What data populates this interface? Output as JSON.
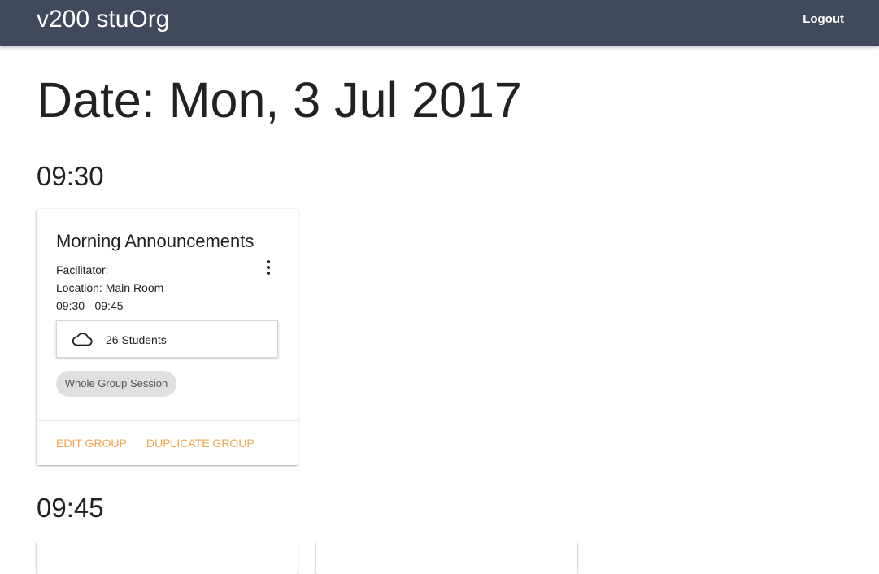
{
  "header": {
    "brand": "v200 stuOrg",
    "logout_label": "Logout"
  },
  "page": {
    "title": "Date: Mon, 3 Jul 2017"
  },
  "slots": [
    {
      "time": "09:30",
      "cards": [
        {
          "title": "Morning Announcements",
          "facilitator": "Facilitator:",
          "location": "Location: Main Room",
          "time_range": "09:30 - 09:45",
          "students": "26 Students",
          "students_icon": "cloud-icon",
          "chip": "Whole Group Session",
          "actions": [
            "EDIT GROUP",
            "DUPLICATE GROUP"
          ],
          "menu_icon": "more-vert-icon"
        }
      ]
    },
    {
      "time": "09:45",
      "cards": []
    }
  ],
  "colors": {
    "topbar": "#414a5c",
    "accent": "#f0a44f",
    "chip_bg": "#e0e0e0"
  }
}
